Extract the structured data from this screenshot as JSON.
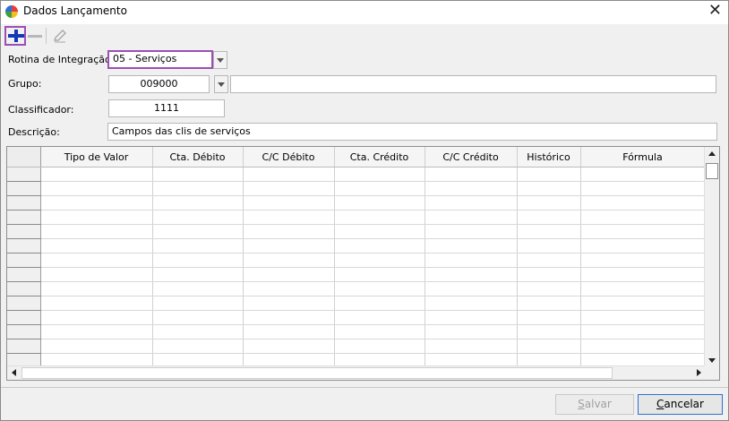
{
  "window": {
    "title": "Dados Lançamento"
  },
  "toolbar": {
    "add": "add-icon",
    "remove": "remove-icon",
    "edit": "edit-icon"
  },
  "form": {
    "rotina_label": "Rotina de Integração:",
    "rotina_value": "05 - Serviços",
    "grupo_label": "Grupo:",
    "grupo_value": "009000",
    "grupo_desc": "",
    "classificador_label": "Classificador:",
    "classificador_value": "1111",
    "descricao_label": "Descrição:",
    "descricao_value": "Campos das clis de serviços"
  },
  "grid": {
    "columns": [
      "Tipo de Valor",
      "Cta. Débito",
      "C/C Débito",
      "Cta. Crédito",
      "C/C Crédito",
      "Histórico",
      "Fórmula"
    ],
    "rows": [
      [],
      [],
      [],
      [],
      [],
      [],
      [],
      [],
      [],
      [],
      [],
      [],
      [],
      []
    ]
  },
  "buttons": {
    "salvar_first": "S",
    "salvar_rest": "alvar",
    "cancelar_first": "C",
    "cancelar_rest": "ancelar"
  },
  "colors": {
    "highlight": "#9b4fb6",
    "add_icon": "#1636b8"
  }
}
